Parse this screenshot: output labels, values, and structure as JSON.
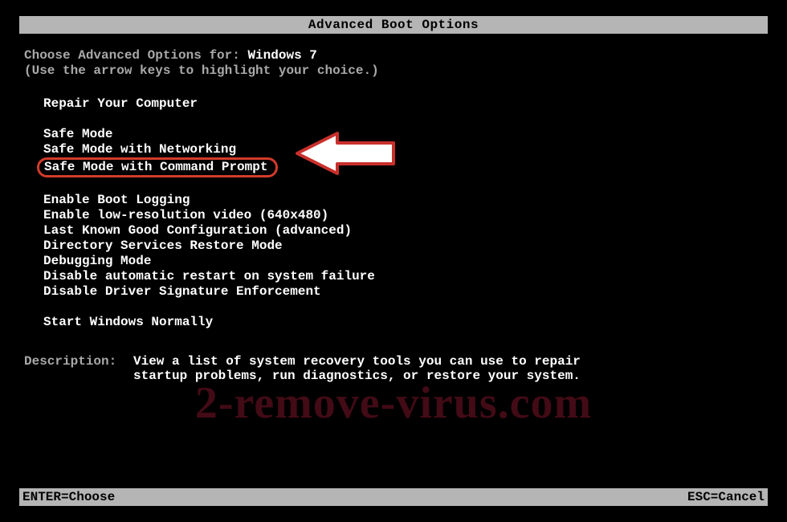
{
  "title": "Advanced Boot Options",
  "choose_prefix": "Choose Advanced Options for: ",
  "os_name": "Windows 7",
  "hint": "(Use the arrow keys to highlight your choice.)",
  "menu": {
    "group1": [
      "Repair Your Computer"
    ],
    "group2": [
      "Safe Mode",
      "Safe Mode with Networking",
      "Safe Mode with Command Prompt"
    ],
    "group3": [
      "Enable Boot Logging",
      "Enable low-resolution video (640x480)",
      "Last Known Good Configuration (advanced)",
      "Directory Services Restore Mode",
      "Debugging Mode",
      "Disable automatic restart on system failure",
      "Disable Driver Signature Enforcement"
    ],
    "group4": [
      "Start Windows Normally"
    ]
  },
  "selected_label": "Safe Mode with Command Prompt",
  "description": {
    "label": "Description:",
    "text": "View a list of system recovery tools you can use to repair\nstartup problems, run diagnostics, or restore your system."
  },
  "footer": {
    "enter": "ENTER=Choose",
    "esc": "ESC=Cancel"
  },
  "watermark": "2-remove-virus.com"
}
